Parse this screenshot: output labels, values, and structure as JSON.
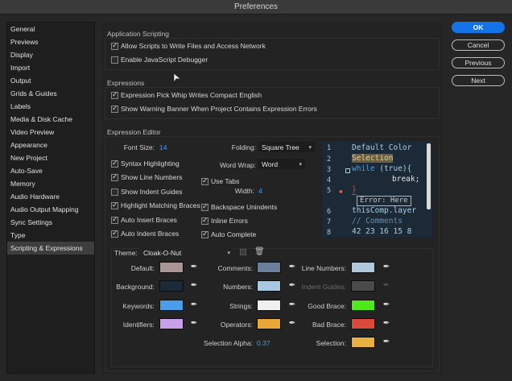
{
  "window": {
    "title": "Preferences"
  },
  "sidebar": {
    "items": [
      {
        "label": "General"
      },
      {
        "label": "Previews"
      },
      {
        "label": "Display"
      },
      {
        "label": "Import"
      },
      {
        "label": "Output"
      },
      {
        "label": "Grids & Guides"
      },
      {
        "label": "Labels"
      },
      {
        "label": "Media & Disk Cache"
      },
      {
        "label": "Video Preview"
      },
      {
        "label": "Appearance"
      },
      {
        "label": "New Project"
      },
      {
        "label": "Auto-Save"
      },
      {
        "label": "Memory"
      },
      {
        "label": "Audio Hardware"
      },
      {
        "label": "Audio Output Mapping"
      },
      {
        "label": "Sync Settings"
      },
      {
        "label": "Type"
      },
      {
        "label": "Scripting & Expressions"
      }
    ],
    "selected": "Scripting & Expressions"
  },
  "app_scripting": {
    "title": "Application Scripting",
    "allow_scripts": {
      "label": "Allow Scripts to Write Files and Access Network",
      "checked": true
    },
    "js_debugger": {
      "label": "Enable JavaScript Debugger",
      "checked": false
    }
  },
  "expressions": {
    "title": "Expressions",
    "pick_whip": {
      "label": "Expression Pick Whip Writes Compact English",
      "checked": true
    },
    "warning_banner": {
      "label": "Show Warning Banner When Project Contains Expression Errors",
      "checked": true
    }
  },
  "editor": {
    "title": "Expression Editor",
    "font_size_label": "Font Size:",
    "font_size_value": "14",
    "folding_label": "Folding:",
    "folding_value": "Square Tree",
    "word_wrap_label": "Word Wrap:",
    "word_wrap_value": "Word",
    "use_tabs": {
      "label": "Use Tabs",
      "checked": true
    },
    "width_label": "Width:",
    "width_value": "4",
    "syntax_highlighting": {
      "label": "Syntax Highlighting",
      "checked": true
    },
    "show_line_numbers": {
      "label": "Show Line Numbers",
      "checked": true
    },
    "show_indent_guides": {
      "label": "Show Indent Guides",
      "checked": false
    },
    "highlight_braces": {
      "label": "Highlight Matching Braces",
      "checked": true
    },
    "auto_insert_braces": {
      "label": "Auto Insert Braces",
      "checked": true
    },
    "auto_indent_braces": {
      "label": "Auto Indent Braces",
      "checked": true
    },
    "backspace_unindents": {
      "label": "Backspace Unindents",
      "checked": true
    },
    "inline_errors": {
      "label": "Inline Errors",
      "checked": true
    },
    "auto_complete": {
      "label": "Auto Complete",
      "checked": true
    }
  },
  "preview": {
    "line_numbers": [
      "1",
      "2",
      "3",
      "4",
      "5",
      "6",
      "7",
      "8"
    ],
    "line1": "Default Color",
    "line2": "Selection",
    "line3_kw": "while",
    "line3_rest": " (true){",
    "line4": "break;",
    "line5": "}",
    "error": "Error: Here",
    "line6": "thisComp.layer",
    "line7": "// Comments",
    "line8": "42 23 16 15 8",
    "colors": {
      "background": "#1c2a38",
      "default": "#a8cde4",
      "keyword": "#4a9ee8",
      "comment": "#6f8ca6",
      "number": "#a8cde4",
      "selection": "#c4a55a",
      "bad_brace": "#d84a3c",
      "error_marker": "#e0604a"
    }
  },
  "theme": {
    "label": "Theme:",
    "value": "Cloak-O-Nut",
    "swatches": [
      {
        "label": "Default:",
        "color": "#a89594",
        "disabled": false
      },
      {
        "label": "Background:",
        "color": "#1c2a38",
        "disabled": false
      },
      {
        "label": "Keywords:",
        "color": "#4a9ee8",
        "disabled": false
      },
      {
        "label": "Identifiers:",
        "color": "#c8a0e8",
        "disabled": false
      },
      {
        "label": "Comments:",
        "color": "#6a7f99",
        "disabled": false
      },
      {
        "label": "Numbers:",
        "color": "#a8c8e0",
        "disabled": false
      },
      {
        "label": "Strings:",
        "color": "#f0f0f0",
        "disabled": false
      },
      {
        "label": "Operators:",
        "color": "#e8a838",
        "disabled": false
      },
      {
        "label": "Line Numbers:",
        "color": "#b0c8dc",
        "disabled": false
      },
      {
        "label": "Indent Guides:",
        "color": "#4a4a4a",
        "disabled": true
      },
      {
        "label": "Good Brace:",
        "color": "#4ee81c",
        "disabled": false
      },
      {
        "label": "Bad Brace:",
        "color": "#d84a3c",
        "disabled": false
      },
      {
        "label": "Selection:",
        "color": "#e8b040",
        "disabled": false
      }
    ],
    "selection_alpha_label": "Selection Alpha:",
    "selection_alpha_value": "0.37"
  },
  "buttons": {
    "ok": "OK",
    "cancel": "Cancel",
    "previous": "Previous",
    "next": "Next"
  }
}
